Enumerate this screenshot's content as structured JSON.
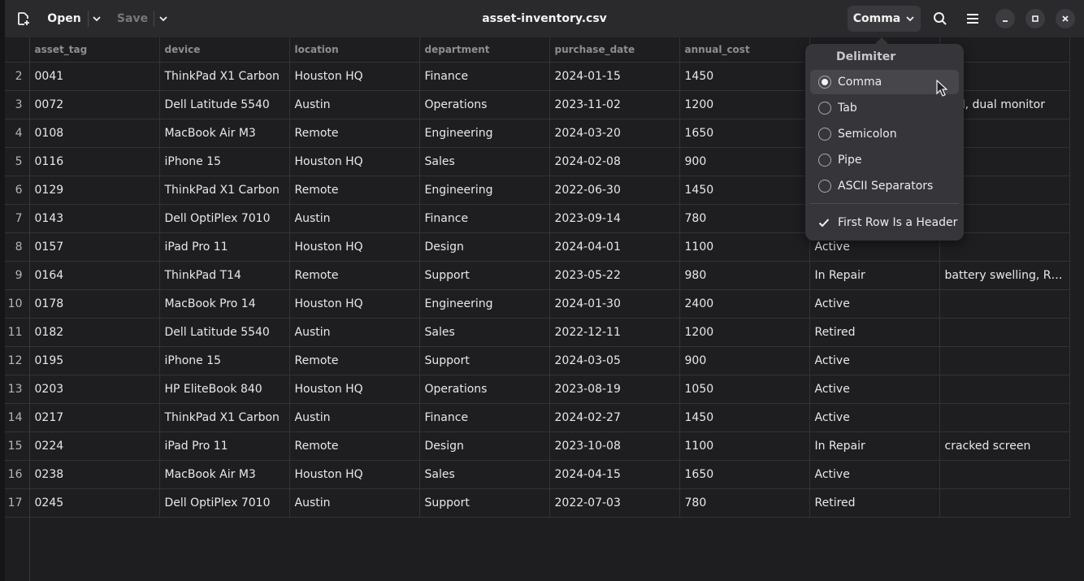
{
  "header": {
    "open_label": "Open",
    "save_label": "Save",
    "title": "asset-inventory.csv",
    "delimiter_button_label": "Comma"
  },
  "table": {
    "columns": [
      "asset_tag",
      "device",
      "location",
      "department",
      "purchase_date",
      "annual_cost",
      "",
      "es"
    ],
    "rows": [
      {
        "n": "2",
        "cells": [
          "0041",
          "ThinkPad X1 Carbon",
          "Houston HQ",
          "Finance",
          "2024-01-15",
          "1450",
          "",
          ""
        ]
      },
      {
        "n": "3",
        "cells": [
          "0072",
          "Dell Latitude 5540",
          "Austin",
          "Operations",
          "2023-11-02",
          "1200",
          "",
          "ked, dual monitor"
        ]
      },
      {
        "n": "4",
        "cells": [
          "0108",
          "MacBook Air M3",
          "Remote",
          "Engineering",
          "2024-03-20",
          "1650",
          "",
          ""
        ]
      },
      {
        "n": "5",
        "cells": [
          "0116",
          "iPhone 15",
          "Houston HQ",
          "Sales",
          "2024-02-08",
          "900",
          "",
          ""
        ]
      },
      {
        "n": "6",
        "cells": [
          "0129",
          "ThinkPad X1 Carbon",
          "Remote",
          "Engineering",
          "2022-06-30",
          "1450",
          "",
          ""
        ]
      },
      {
        "n": "7",
        "cells": [
          "0143",
          "Dell OptiPlex 7010",
          "Austin",
          "Finance",
          "2023-09-14",
          "780",
          "",
          ""
        ]
      },
      {
        "n": "8",
        "cells": [
          "0157",
          "iPad Pro 11",
          "Houston HQ",
          "Design",
          "2024-04-01",
          "1100",
          "Active",
          ""
        ]
      },
      {
        "n": "9",
        "cells": [
          "0164",
          "ThinkPad T14",
          "Remote",
          "Support",
          "2023-05-22",
          "980",
          "In Repair",
          "battery swelling, R…"
        ]
      },
      {
        "n": "10",
        "cells": [
          "0178",
          "MacBook Pro 14",
          "Houston HQ",
          "Engineering",
          "2024-01-30",
          "2400",
          "Active",
          ""
        ]
      },
      {
        "n": "11",
        "cells": [
          "0182",
          "Dell Latitude 5540",
          "Austin",
          "Sales",
          "2022-12-11",
          "1200",
          "Retired",
          ""
        ]
      },
      {
        "n": "12",
        "cells": [
          "0195",
          "iPhone 15",
          "Remote",
          "Support",
          "2024-03-05",
          "900",
          "Active",
          ""
        ]
      },
      {
        "n": "13",
        "cells": [
          "0203",
          "HP EliteBook 840",
          "Houston HQ",
          "Operations",
          "2023-08-19",
          "1050",
          "Active",
          ""
        ]
      },
      {
        "n": "14",
        "cells": [
          "0217",
          "ThinkPad X1 Carbon",
          "Austin",
          "Finance",
          "2024-02-27",
          "1450",
          "Active",
          ""
        ]
      },
      {
        "n": "15",
        "cells": [
          "0224",
          "iPad Pro 11",
          "Remote",
          "Design",
          "2023-10-08",
          "1100",
          "In Repair",
          "cracked screen"
        ]
      },
      {
        "n": "16",
        "cells": [
          "0238",
          "MacBook Air M3",
          "Houston HQ",
          "Sales",
          "2024-04-15",
          "1650",
          "Active",
          ""
        ]
      },
      {
        "n": "17",
        "cells": [
          "0245",
          "Dell OptiPlex 7010",
          "Austin",
          "Support",
          "2022-07-03",
          "780",
          "Retired",
          ""
        ]
      }
    ]
  },
  "popover": {
    "heading": "Delimiter",
    "options": [
      {
        "label": "Comma",
        "selected": true
      },
      {
        "label": "Tab",
        "selected": false
      },
      {
        "label": "Semicolon",
        "selected": false
      },
      {
        "label": "Pipe",
        "selected": false
      },
      {
        "label": "ASCII Separators",
        "selected": false
      }
    ],
    "header_toggle_label": "First Row Is a Header",
    "header_toggle_checked": true
  },
  "colors": {
    "background": "#1e1e20",
    "headerbar": "#2a2a2d",
    "popover": "#36363a"
  }
}
